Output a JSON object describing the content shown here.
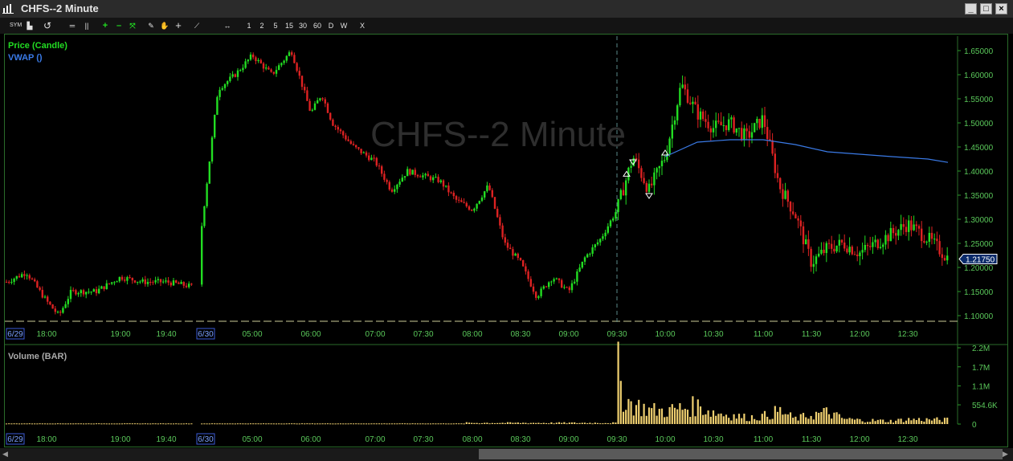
{
  "window": {
    "title": "CHFS--2 Minute",
    "watermark": "CHFS--2 Minute"
  },
  "toolbar": {
    "icons": [
      "symbol-icon",
      "chart-type-icon",
      "refresh-icon",
      "bar-width-icon",
      "bar-width-icon",
      "zoom-in-icon",
      "zoom-out-icon",
      "zoom-fit-icon",
      "draw-icon",
      "pan-icon",
      "crosshair-icon",
      "trendline-icon",
      "scroll-icon"
    ],
    "periods": [
      "1",
      "2",
      "5",
      "15",
      "30",
      "60",
      "D",
      "W"
    ],
    "close_label": "X"
  },
  "price_panel": {
    "series1": "Price (Candle)",
    "series2": "VWAP ()",
    "last_price": "1.21750"
  },
  "volume_panel": {
    "label": "Volume (BAR)"
  },
  "colors": {
    "up": "#22dd22",
    "down": "#dd2222",
    "vwap": "#3a7ae6",
    "volume": "#f0d070",
    "grid": "#2a6b2a",
    "frame": "#2a6b2a"
  },
  "chart_data": {
    "type": "candlestick",
    "title": "CHFS--2 Minute",
    "x_ticks": [
      "6/29",
      "18:00",
      "19:00",
      "19:40",
      "6/30",
      "05:00",
      "06:00",
      "07:00",
      "07:30",
      "08:00",
      "08:30",
      "09:00",
      "09:30",
      "10:00",
      "10:30",
      "11:00",
      "11:30",
      "12:00",
      "12:30"
    ],
    "date_markers": [
      "6/29",
      "6/30"
    ],
    "price_ticks": [
      "1.65000",
      "1.60000",
      "1.55000",
      "1.50000",
      "1.45000",
      "1.40000",
      "1.35000",
      "1.30000",
      "1.25000",
      "1.20000",
      "1.15000",
      "1.10000"
    ],
    "price_ylim": [
      1.08,
      1.68
    ],
    "volume_ticks": [
      "2.2M",
      "1.7M",
      "1.1M",
      "554.6K",
      "0"
    ],
    "volume_ylim": [
      0,
      2200000
    ],
    "close_series": [
      [
        "17:20",
        1.17
      ],
      [
        "17:40",
        1.19
      ],
      [
        "18:00",
        1.13
      ],
      [
        "18:10",
        1.1
      ],
      [
        "18:20",
        1.15
      ],
      [
        "18:40",
        1.15
      ],
      [
        "19:00",
        1.18
      ],
      [
        "19:20",
        1.17
      ],
      [
        "19:40",
        1.17
      ],
      [
        "20:00",
        1.16
      ],
      [
        "04:00",
        1.27
      ],
      [
        "04:20",
        1.57
      ],
      [
        "04:40",
        1.6
      ],
      [
        "05:00",
        1.64
      ],
      [
        "05:20",
        1.6
      ],
      [
        "05:40",
        1.65
      ],
      [
        "06:00",
        1.52
      ],
      [
        "06:10",
        1.56
      ],
      [
        "06:20",
        1.5
      ],
      [
        "06:40",
        1.45
      ],
      [
        "07:00",
        1.42
      ],
      [
        "07:10",
        1.36
      ],
      [
        "07:20",
        1.4
      ],
      [
        "07:40",
        1.38
      ],
      [
        "07:50",
        1.34
      ],
      [
        "08:00",
        1.32
      ],
      [
        "08:10",
        1.37
      ],
      [
        "08:20",
        1.25
      ],
      [
        "08:30",
        1.21
      ],
      [
        "08:40",
        1.14
      ],
      [
        "08:50",
        1.18
      ],
      [
        "09:00",
        1.15
      ],
      [
        "09:10",
        1.22
      ],
      [
        "09:20",
        1.26
      ],
      [
        "09:30",
        1.32
      ],
      [
        "09:40",
        1.43
      ],
      [
        "09:50",
        1.36
      ],
      [
        "10:00",
        1.43
      ],
      [
        "10:10",
        1.58
      ],
      [
        "10:20",
        1.52
      ],
      [
        "10:30",
        1.49
      ],
      [
        "10:40",
        1.5
      ],
      [
        "10:50",
        1.47
      ],
      [
        "11:00",
        1.51
      ],
      [
        "11:10",
        1.37
      ],
      [
        "11:20",
        1.31
      ],
      [
        "11:30",
        1.21
      ],
      [
        "11:40",
        1.24
      ],
      [
        "11:50",
        1.25
      ],
      [
        "12:00",
        1.23
      ],
      [
        "12:10",
        1.25
      ],
      [
        "12:20",
        1.27
      ],
      [
        "12:30",
        1.29
      ],
      [
        "12:40",
        1.26
      ],
      [
        "12:50",
        1.22
      ]
    ],
    "vwap_series": [
      [
        "10:00",
        1.43
      ],
      [
        "10:20",
        1.46
      ],
      [
        "10:40",
        1.465
      ],
      [
        "11:00",
        1.465
      ],
      [
        "11:20",
        1.455
      ],
      [
        "11:40",
        1.44
      ],
      [
        "12:00",
        1.435
      ],
      [
        "12:20",
        1.43
      ],
      [
        "12:40",
        1.425
      ],
      [
        "12:50",
        1.418
      ]
    ],
    "volume_series": [
      [
        "09:30",
        2200000
      ],
      [
        "09:32",
        1700000
      ],
      [
        "09:34",
        1100000
      ],
      [
        "09:36",
        900000
      ],
      [
        "09:40",
        750000
      ],
      [
        "09:50",
        550000
      ],
      [
        "10:00",
        500000
      ],
      [
        "10:10",
        600000
      ],
      [
        "10:20",
        700000
      ],
      [
        "10:30",
        450000
      ],
      [
        "10:40",
        350000
      ],
      [
        "10:50",
        250000
      ],
      [
        "11:00",
        300000
      ],
      [
        "11:10",
        500000
      ],
      [
        "11:20",
        200000
      ],
      [
        "11:30",
        350000
      ],
      [
        "11:40",
        450000
      ],
      [
        "11:50",
        200000
      ],
      [
        "12:00",
        150000
      ],
      [
        "12:20",
        120000
      ],
      [
        "12:30",
        180000
      ],
      [
        "12:50",
        160000
      ]
    ],
    "signal_markers": [
      {
        "type": "buy",
        "time": "09:36"
      },
      {
        "type": "sell",
        "time": "09:40"
      },
      {
        "type": "sell",
        "time": "09:50"
      },
      {
        "type": "buy",
        "time": "10:00"
      }
    ],
    "grid": false,
    "xlabel": "",
    "ylabel": ""
  }
}
